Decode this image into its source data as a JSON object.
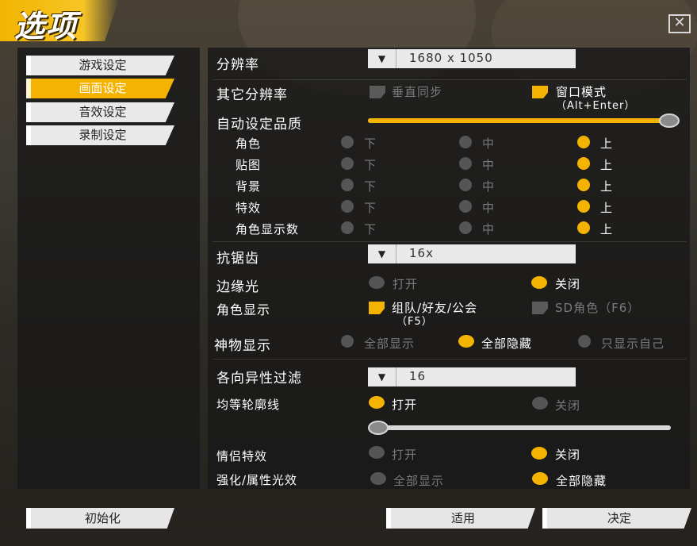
{
  "window": {
    "title": "选项",
    "close_icon": "close-icon",
    "accent_color": "#f5b301"
  },
  "sidebar": {
    "items": [
      {
        "label": "游戏设定",
        "active": false
      },
      {
        "label": "画面设定",
        "active": true
      },
      {
        "label": "音效设定",
        "active": false
      },
      {
        "label": "录制设定",
        "active": false
      }
    ]
  },
  "resolution": {
    "label": "分辨率",
    "value": "1680 x 1050"
  },
  "other_resolution": {
    "label": "其它分辨率",
    "vsync": {
      "label": "垂直同步",
      "checked": false
    },
    "windowed": {
      "label": "窗口模式",
      "hint": "（Alt+Enter）",
      "checked": true
    }
  },
  "auto_quality": {
    "label": "自动设定品质",
    "level": 1.0
  },
  "quality_levels": {
    "low": "下",
    "mid": "中",
    "high": "上"
  },
  "quality_rows": [
    {
      "label": "角色",
      "selected": "high"
    },
    {
      "label": "贴图",
      "selected": "high"
    },
    {
      "label": "背景",
      "selected": "high"
    },
    {
      "label": "特效",
      "selected": "high"
    },
    {
      "label": "角色显示数",
      "selected": "high"
    }
  ],
  "antialias": {
    "label": "抗锯齿",
    "value": "16x"
  },
  "edge_light": {
    "label": "边缘光",
    "on_label": "打开",
    "off_label": "关闭",
    "selected": "off"
  },
  "character_display": {
    "label": "角色显示",
    "party": {
      "label": "组队/好友/公会",
      "hint": "（F5）",
      "checked": true
    },
    "sd": {
      "label": "SD角色（F6）",
      "checked": false
    }
  },
  "artifact_display": {
    "label": "神物显示",
    "options": [
      "全部显示",
      "全部隐藏",
      "只显示自己"
    ],
    "selected": 1
  },
  "anisotropic": {
    "label": "各向异性过滤",
    "value": "16"
  },
  "contour": {
    "label": "均等轮廓线",
    "on_label": "打开",
    "off_label": "关闭",
    "selected": "on",
    "level": 0.0
  },
  "couple_effect": {
    "label": "情侣特效",
    "on_label": "打开",
    "off_label": "关闭",
    "selected": "off"
  },
  "enhance_glow": {
    "label": "强化/属性光效",
    "show_label": "全部显示",
    "hide_label": "全部隐藏",
    "selected": "hide"
  },
  "buttons": {
    "reset": "初始化",
    "apply": "适用",
    "confirm": "决定"
  }
}
